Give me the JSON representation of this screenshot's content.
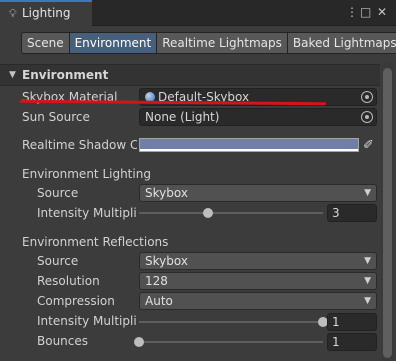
{
  "window": {
    "title": "Lighting",
    "title_icon": "lightbulb-icon",
    "controls": [
      "more-vert-icon",
      "maximize-icon",
      "close-icon"
    ]
  },
  "tabs": [
    {
      "label": "Scene",
      "active": false
    },
    {
      "label": "Environment",
      "active": true
    },
    {
      "label": "Realtime Lightmaps",
      "active": false
    },
    {
      "label": "Baked Lightmaps",
      "active": false
    }
  ],
  "section": {
    "title": "Environment"
  },
  "skybox_material": {
    "label": "Skybox Material",
    "value": "Default-Skybox"
  },
  "sun_source": {
    "label": "Sun Source",
    "value": "None (Light)"
  },
  "realtime_shadow_color": {
    "label": "Realtime Shadow Co",
    "color": "#6f7fa8"
  },
  "environment_lighting": {
    "header": "Environment Lighting",
    "source": {
      "label": "Source",
      "value": "Skybox"
    },
    "intensity": {
      "label": "Intensity Multiplie",
      "value": "3",
      "fraction": 0.375
    }
  },
  "environment_reflections": {
    "header": "Environment Reflections",
    "source": {
      "label": "Source",
      "value": "Skybox"
    },
    "resolution": {
      "label": "Resolution",
      "value": "128"
    },
    "compression": {
      "label": "Compression",
      "value": "Auto"
    },
    "intensity": {
      "label": "Intensity Multiplie",
      "value": "1",
      "fraction": 1.0
    },
    "bounces": {
      "label": "Bounces",
      "value": "1",
      "fraction": 0.0
    }
  },
  "colors": {
    "accent": "#3a79bb",
    "active_tab": "#46607c",
    "annotation": "#d4141c"
  }
}
